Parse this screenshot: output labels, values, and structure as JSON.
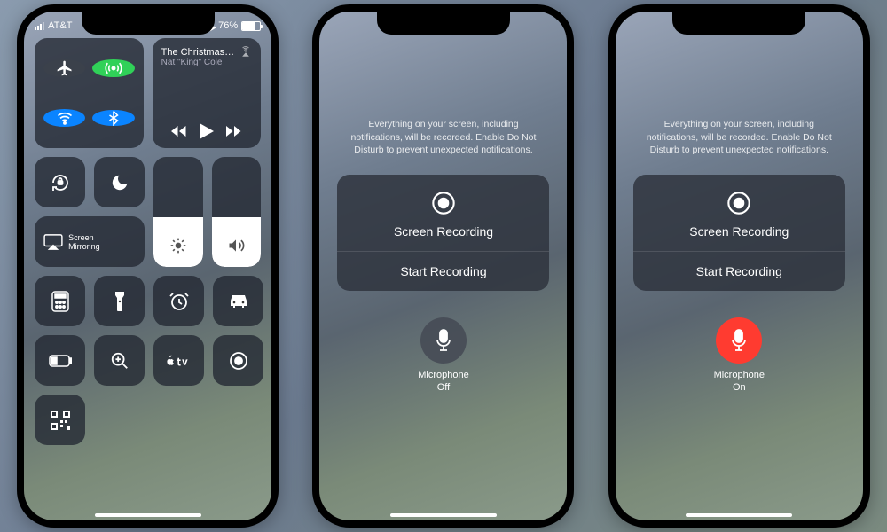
{
  "status": {
    "carrier": "AT&T",
    "battery_pct": "76%"
  },
  "music": {
    "title": "The Christmas…",
    "artist": "Nat \"King\" Cole"
  },
  "mirroring_label": "Screen\nMirroring",
  "modal": {
    "hint": "Everything on your screen, including notifications, will be recorded. Enable Do Not Disturb to prevent unexpected notifications.",
    "title": "Screen Recording",
    "action": "Start Recording",
    "mic_label": "Microphone",
    "mic_off": "Off",
    "mic_on": "On"
  },
  "colors": {
    "green": "#30d158",
    "blue": "#0a84ff",
    "red": "#ff3b30"
  }
}
